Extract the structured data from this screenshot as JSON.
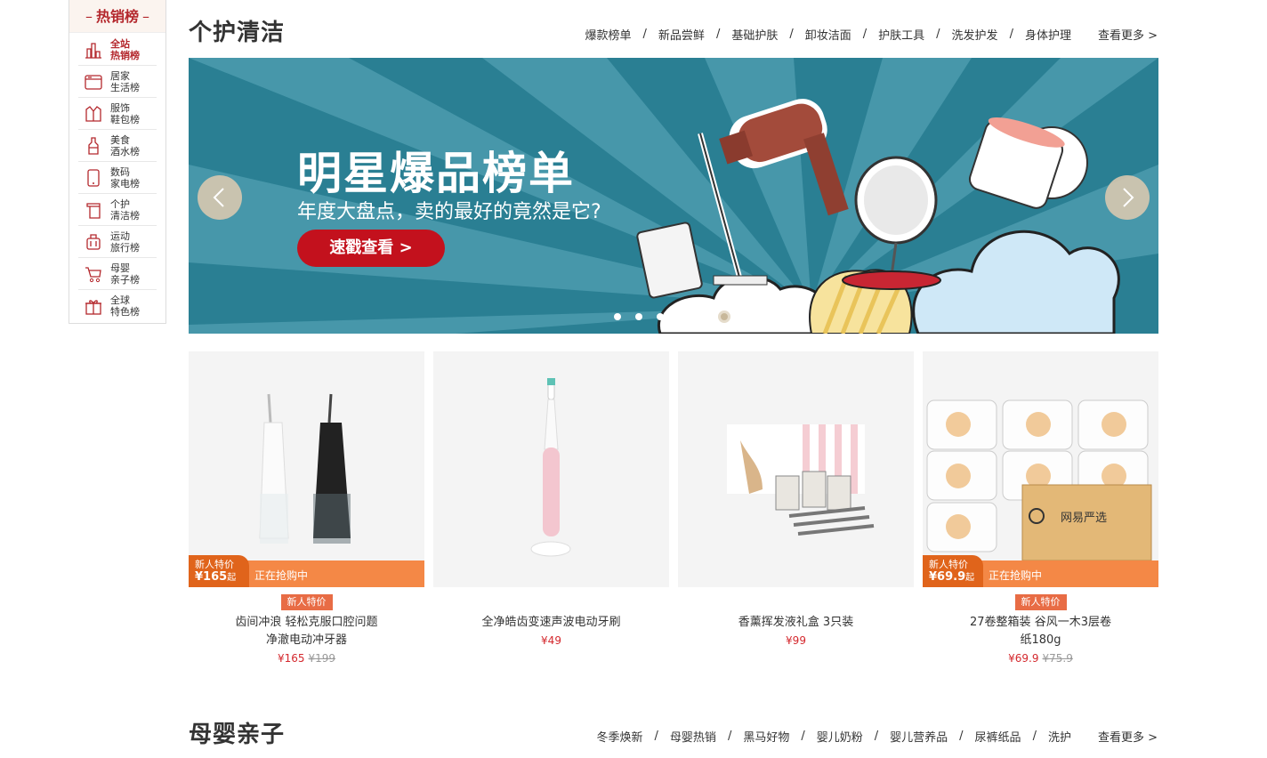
{
  "sidenav": {
    "title": "热销榜",
    "items": [
      {
        "label": "全站热销榜",
        "line1": "全站",
        "line2": "热销榜",
        "icon": "chart-bars-icon"
      },
      {
        "label": "居家生活榜",
        "line1": "居家",
        "line2": "生活榜",
        "icon": "home-appliance-icon"
      },
      {
        "label": "服饰鞋包榜",
        "line1": "服饰",
        "line2": "鞋包榜",
        "icon": "shirt-icon"
      },
      {
        "label": "美食酒水榜",
        "line1": "美食",
        "line2": "酒水榜",
        "icon": "bottle-icon"
      },
      {
        "label": "数码家电榜",
        "line1": "数码",
        "line2": "家电榜",
        "icon": "phone-icon"
      },
      {
        "label": "个护清洁榜",
        "line1": "个护",
        "line2": "清洁榜",
        "icon": "towel-icon"
      },
      {
        "label": "运动旅行榜",
        "line1": "运动",
        "line2": "旅行榜",
        "icon": "luggage-icon"
      },
      {
        "label": "母婴亲子榜",
        "line1": "母婴",
        "line2": "亲子榜",
        "icon": "stroller-icon"
      },
      {
        "label": "全球特色榜",
        "line1": "全球",
        "line2": "特色榜",
        "icon": "gift-icon"
      }
    ]
  },
  "section1": {
    "title": "个护清洁",
    "tabs": [
      "爆款榜单",
      "新品尝鲜",
      "基础护肤",
      "卸妆洁面",
      "护肤工具",
      "洗发护发",
      "身体护理"
    ],
    "more": "查看更多 >"
  },
  "banner": {
    "title": "明星爆品榜单",
    "subtitle": "年度大盘点，卖的最好的竟然是它?",
    "button": "速戳查看 >",
    "slide_count": 6,
    "active_slide": 6
  },
  "products": [
    {
      "name": "齿间冲浪 轻松克服口腔问题净澈电动冲牙器",
      "name_l1": "齿间冲浪 轻松克服口腔问题",
      "name_l2": "净澈电动冲牙器",
      "price": "¥165",
      "old_price": "¥199",
      "badge": "新人特价",
      "promo_label": "新人特价",
      "promo_price": "¥165",
      "promo_suffix": "起",
      "promo_status": "正在抢购中"
    },
    {
      "name": "全净皓齿变速声波电动牙刷",
      "price": "¥49"
    },
    {
      "name": "香薰挥发液礼盒 3只装",
      "price": "¥99"
    },
    {
      "name": "27卷整箱装 谷风一木3层卷纸180g",
      "name_l1": "27卷整箱装 谷风一木3层卷",
      "name_l2": "纸180g",
      "price": "¥69.9",
      "old_price": "¥75.9",
      "badge": "新人特价",
      "promo_label": "新人特价",
      "promo_price": "¥69.9",
      "promo_suffix": "起",
      "promo_status": "正在抢购中",
      "box_brand": "网易严选"
    }
  ],
  "section2": {
    "title": "母婴亲子",
    "tabs": [
      "冬季焕新",
      "母婴热销",
      "黑马好物",
      "婴儿奶粉",
      "婴儿营养品",
      "尿裤纸品",
      "洗护"
    ],
    "more": "查看更多 >"
  },
  "colors": {
    "brand_red": "#b4282d",
    "promo_orange": "#f48846",
    "banner_teal": "#2a7f93"
  }
}
